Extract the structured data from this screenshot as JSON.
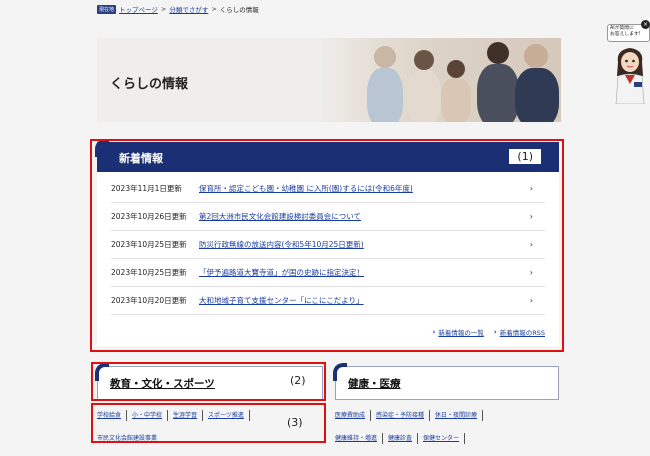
{
  "breadcrumb": {
    "badge": "現在地",
    "items": [
      "トップページ",
      "分類でさがす",
      "くらしの情報"
    ],
    "separator": ">"
  },
  "hero": {
    "title": "くらしの情報"
  },
  "news": {
    "heading": "新着情報",
    "annotation": "(1)",
    "items": [
      {
        "date": "2023年11月1日更新",
        "title": "保育所・認定こども園・幼稚園 に入所(園)するには(令和6年度)"
      },
      {
        "date": "2023年10月26日更新",
        "title": "第2回大洲市民文化会館建設検討委員会について"
      },
      {
        "date": "2023年10月25日更新",
        "title": "防災行政無線の放送内容(令和5年10月25日更新)"
      },
      {
        "date": "2023年10月25日更新",
        "title": "「伊予遍路道大寶寺道」が国の史跡に指定決定！"
      },
      {
        "date": "2023年10月20日更新",
        "title": "大和地域子育て支援センター「にこにこだより」"
      }
    ],
    "chevron": "›",
    "more_links": [
      "新着情報の一覧",
      "新着情報のRSS"
    ],
    "more_arrow": "›"
  },
  "categories": [
    {
      "label": "教育・文化・スポーツ",
      "annotation": "(2)",
      "links_annotation": "(3)",
      "links": [
        [
          "学校給食",
          "小・中学校",
          "生涯学習",
          "スポーツ推進"
        ],
        [
          "市民文化会館建設事業"
        ]
      ]
    },
    {
      "label": "健康・医療",
      "links": [
        [
          "医療費助成",
          "感染症・予防接種",
          "休日・夜間診療"
        ],
        [
          "健康維持・増進",
          "健康診査",
          "保健センター"
        ]
      ]
    }
  ],
  "helper": {
    "bubble": "AIが質問に\nお答えします!",
    "close": "×"
  },
  "colors": {
    "navy": "#1b2f75",
    "link": "#1a3c9e",
    "annotation": "#e01010"
  }
}
